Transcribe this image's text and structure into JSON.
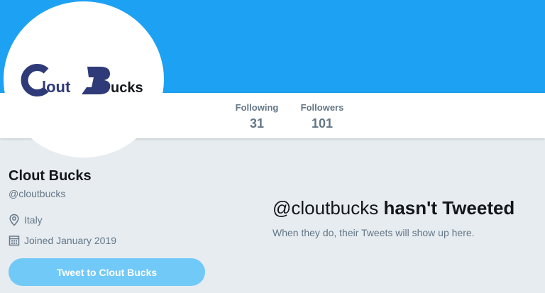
{
  "profile": {
    "logo_text": "CloutBucks",
    "name": "Clout Bucks",
    "handle": "@cloutbucks",
    "location": "Italy",
    "joined": "Joined January 2019"
  },
  "stats": [
    {
      "label": "Following",
      "value": "31"
    },
    {
      "label": "Followers",
      "value": "101"
    }
  ],
  "actions": {
    "tweet_to_label": "Tweet to Clout Bucks"
  },
  "timeline_empty": {
    "title_handle": "@cloutbucks",
    "title_rest": "hasn't Tweeted",
    "subtitle": "When they do, their Tweets will show up here."
  },
  "colors": {
    "banner": "#1da1f2",
    "page_background": "#e6ecf0",
    "button": "#71c9f8",
    "logo_navy": "#2f3a78",
    "muted_text": "#657786"
  },
  "icons": {
    "location": "location-pin-icon",
    "joined": "calendar-icon"
  }
}
